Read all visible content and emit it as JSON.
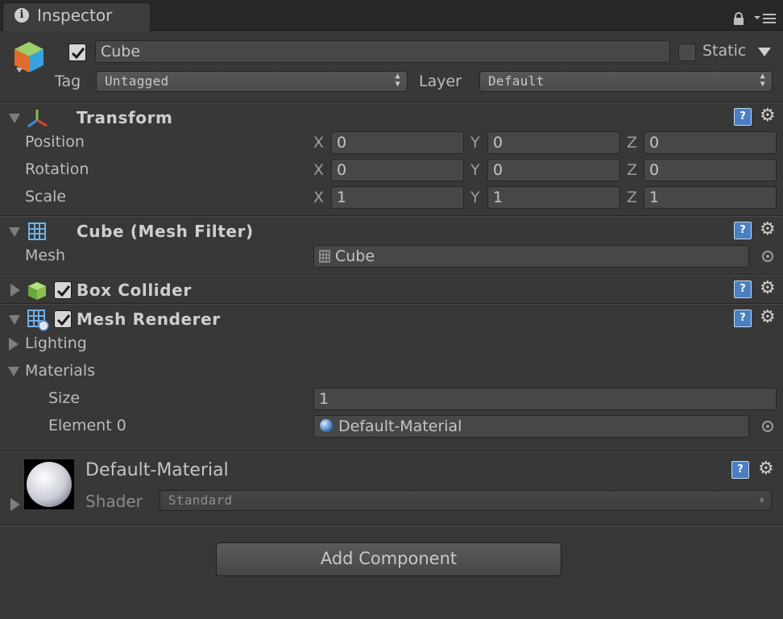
{
  "tab": {
    "title": "Inspector",
    "info_icon": "info-icon",
    "lock_icon": "lock-icon",
    "menu_icon": "tab-menu-icon"
  },
  "header": {
    "name": "Cube",
    "active_checked": true,
    "static_label": "Static",
    "static_checked": false,
    "tag_label": "Tag",
    "tag_value": "Untagged",
    "layer_label": "Layer",
    "layer_value": "Default"
  },
  "transform": {
    "title": "Transform",
    "rows": [
      {
        "label": "Position",
        "x": "0",
        "y": "0",
        "z": "0"
      },
      {
        "label": "Rotation",
        "x": "0",
        "y": "0",
        "z": "0"
      },
      {
        "label": "Scale",
        "x": "1",
        "y": "1",
        "z": "1"
      }
    ],
    "axis_labels": {
      "x": "X",
      "y": "Y",
      "z": "Z"
    }
  },
  "mesh_filter": {
    "title": "Cube (Mesh Filter)",
    "mesh_label": "Mesh",
    "mesh_value": "Cube"
  },
  "box_collider": {
    "title": "Box Collider",
    "enabled": true
  },
  "mesh_renderer": {
    "title": "Mesh Renderer",
    "enabled": true,
    "lighting_label": "Lighting",
    "materials_label": "Materials",
    "size_label": "Size",
    "size_value": "1",
    "element0_label": "Element 0",
    "element0_value": "Default-Material"
  },
  "material": {
    "name": "Default-Material",
    "shader_label": "Shader",
    "shader_value": "Standard"
  },
  "add_component_label": "Add Component",
  "colors": {
    "background": "#383838",
    "tab_bar": "#282828",
    "help_blue": "#4a7fc1",
    "text": "#bdbdbd"
  }
}
